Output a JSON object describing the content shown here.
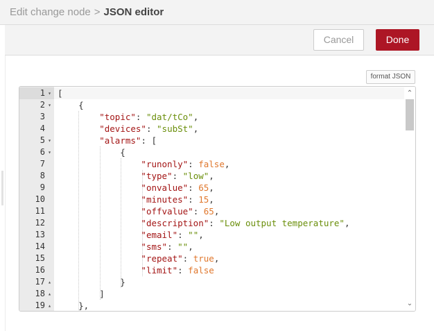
{
  "header": {
    "crumb_parent": "Edit change node",
    "crumb_separator": ">",
    "crumb_current": "JSON editor"
  },
  "toolbar": {
    "cancel_label": "Cancel",
    "done_label": "Done"
  },
  "colors": {
    "done_button": "#ad1625",
    "json_key": "#a31515",
    "json_string": "#6a8e0a",
    "json_number": "#e0772c"
  },
  "editor": {
    "format_label": "format JSON",
    "lines": [
      {
        "num": "1",
        "fold": "▾",
        "tokens": [
          {
            "t": "[",
            "c": "punc"
          }
        ]
      },
      {
        "num": "2",
        "fold": "▾",
        "tokens": [
          {
            "t": "    {",
            "c": "punc"
          }
        ]
      },
      {
        "num": "3",
        "fold": "",
        "tokens": [
          {
            "t": "        ",
            "c": "punc"
          },
          {
            "t": "\"topic\"",
            "c": "key"
          },
          {
            "t": ": ",
            "c": "punc"
          },
          {
            "t": "\"dat/tCo\"",
            "c": "str"
          },
          {
            "t": ",",
            "c": "punc"
          }
        ]
      },
      {
        "num": "4",
        "fold": "",
        "tokens": [
          {
            "t": "        ",
            "c": "punc"
          },
          {
            "t": "\"devices\"",
            "c": "key"
          },
          {
            "t": ": ",
            "c": "punc"
          },
          {
            "t": "\"subSt\"",
            "c": "str"
          },
          {
            "t": ",",
            "c": "punc"
          }
        ]
      },
      {
        "num": "5",
        "fold": "▾",
        "tokens": [
          {
            "t": "        ",
            "c": "punc"
          },
          {
            "t": "\"alarms\"",
            "c": "key"
          },
          {
            "t": ": [",
            "c": "punc"
          }
        ]
      },
      {
        "num": "6",
        "fold": "▾",
        "tokens": [
          {
            "t": "            {",
            "c": "punc"
          }
        ]
      },
      {
        "num": "7",
        "fold": "",
        "tokens": [
          {
            "t": "                ",
            "c": "punc"
          },
          {
            "t": "\"runonly\"",
            "c": "key"
          },
          {
            "t": ": ",
            "c": "punc"
          },
          {
            "t": "false",
            "c": "bool"
          },
          {
            "t": ",",
            "c": "punc"
          }
        ]
      },
      {
        "num": "8",
        "fold": "",
        "tokens": [
          {
            "t": "                ",
            "c": "punc"
          },
          {
            "t": "\"type\"",
            "c": "key"
          },
          {
            "t": ": ",
            "c": "punc"
          },
          {
            "t": "\"low\"",
            "c": "str"
          },
          {
            "t": ",",
            "c": "punc"
          }
        ]
      },
      {
        "num": "9",
        "fold": "",
        "tokens": [
          {
            "t": "                ",
            "c": "punc"
          },
          {
            "t": "\"onvalue\"",
            "c": "key"
          },
          {
            "t": ": ",
            "c": "punc"
          },
          {
            "t": "65",
            "c": "num"
          },
          {
            "t": ",",
            "c": "punc"
          }
        ]
      },
      {
        "num": "10",
        "fold": "",
        "tokens": [
          {
            "t": "                ",
            "c": "punc"
          },
          {
            "t": "\"minutes\"",
            "c": "key"
          },
          {
            "t": ": ",
            "c": "punc"
          },
          {
            "t": "15",
            "c": "num"
          },
          {
            "t": ",",
            "c": "punc"
          }
        ]
      },
      {
        "num": "11",
        "fold": "",
        "tokens": [
          {
            "t": "                ",
            "c": "punc"
          },
          {
            "t": "\"offvalue\"",
            "c": "key"
          },
          {
            "t": ": ",
            "c": "punc"
          },
          {
            "t": "65",
            "c": "num"
          },
          {
            "t": ",",
            "c": "punc"
          }
        ]
      },
      {
        "num": "12",
        "fold": "",
        "tokens": [
          {
            "t": "                ",
            "c": "punc"
          },
          {
            "t": "\"description\"",
            "c": "key"
          },
          {
            "t": ": ",
            "c": "punc"
          },
          {
            "t": "\"Low output temperature\"",
            "c": "str"
          },
          {
            "t": ",",
            "c": "punc"
          }
        ]
      },
      {
        "num": "13",
        "fold": "",
        "tokens": [
          {
            "t": "                ",
            "c": "punc"
          },
          {
            "t": "\"email\"",
            "c": "key"
          },
          {
            "t": ": ",
            "c": "punc"
          },
          {
            "t": "\"\"",
            "c": "str"
          },
          {
            "t": ",",
            "c": "punc"
          }
        ]
      },
      {
        "num": "14",
        "fold": "",
        "tokens": [
          {
            "t": "                ",
            "c": "punc"
          },
          {
            "t": "\"sms\"",
            "c": "key"
          },
          {
            "t": ": ",
            "c": "punc"
          },
          {
            "t": "\"\"",
            "c": "str"
          },
          {
            "t": ",",
            "c": "punc"
          }
        ]
      },
      {
        "num": "15",
        "fold": "",
        "tokens": [
          {
            "t": "                ",
            "c": "punc"
          },
          {
            "t": "\"repeat\"",
            "c": "key"
          },
          {
            "t": ": ",
            "c": "punc"
          },
          {
            "t": "true",
            "c": "bool"
          },
          {
            "t": ",",
            "c": "punc"
          }
        ]
      },
      {
        "num": "16",
        "fold": "",
        "tokens": [
          {
            "t": "                ",
            "c": "punc"
          },
          {
            "t": "\"limit\"",
            "c": "key"
          },
          {
            "t": ": ",
            "c": "punc"
          },
          {
            "t": "false",
            "c": "bool"
          }
        ]
      },
      {
        "num": "17",
        "fold": "▴",
        "tokens": [
          {
            "t": "            }",
            "c": "punc"
          }
        ]
      },
      {
        "num": "18",
        "fold": "▴",
        "tokens": [
          {
            "t": "        ]",
            "c": "punc"
          }
        ]
      },
      {
        "num": "19",
        "fold": "▴",
        "tokens": [
          {
            "t": "    },",
            "c": "punc"
          }
        ]
      }
    ]
  }
}
